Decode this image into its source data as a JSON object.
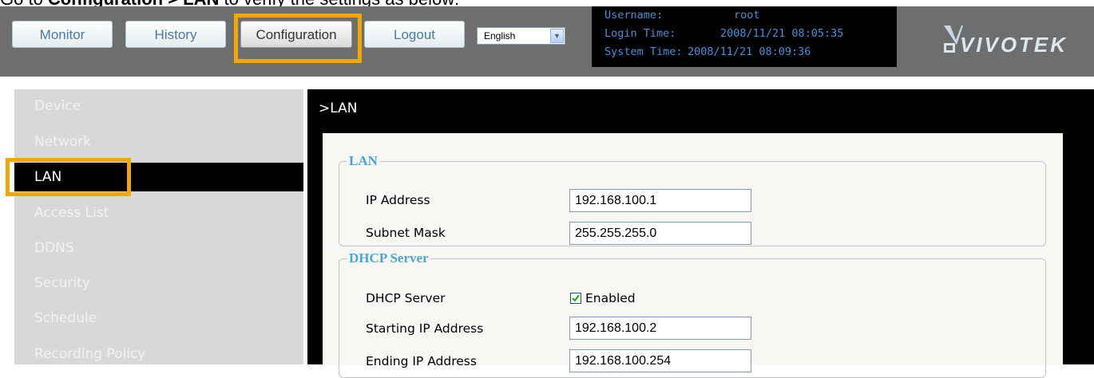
{
  "caption": {
    "prefix": "Go to ",
    "bold_text": "Configuration > LAN",
    "suffix": " to verify the settings as below:"
  },
  "nav": {
    "monitor": "Monitor",
    "history": "History",
    "configuration": "Configuration",
    "logout": "Logout"
  },
  "language": {
    "selected": "English"
  },
  "status": {
    "username_label": "Username:",
    "username_value": "root",
    "login_label": "Login Time:",
    "login_value": "2008/11/21 08:05:35",
    "system_label": "System Time:",
    "system_value": "2008/11/21 08:09:36"
  },
  "logo": {
    "text": "VIVOTEK"
  },
  "sidebar": {
    "items": [
      {
        "label": "Device"
      },
      {
        "label": "Network"
      },
      {
        "label": "LAN"
      },
      {
        "label": "Access List"
      },
      {
        "label": "DDNS"
      },
      {
        "label": "Security"
      },
      {
        "label": "Schedule"
      },
      {
        "label": "Recording Policy"
      }
    ],
    "active": "LAN"
  },
  "content": {
    "title": ">LAN",
    "lan": {
      "legend": "LAN",
      "ip_label": "IP Address",
      "ip_value": "192.168.100.1",
      "mask_label": "Subnet Mask",
      "mask_value": "255.255.255.0"
    },
    "dhcp": {
      "legend": "DHCP Server",
      "server_label": "DHCP Server",
      "enabled_label": "Enabled",
      "enabled": true,
      "start_label": "Starting IP Address",
      "start_value": "192.168.100.2",
      "end_label": "Ending IP Address",
      "end_value": "192.168.100.254"
    }
  },
  "colors": {
    "highlight": "#f4a700",
    "legend": "#4aa6d8",
    "status_text": "#4a8fd8"
  }
}
